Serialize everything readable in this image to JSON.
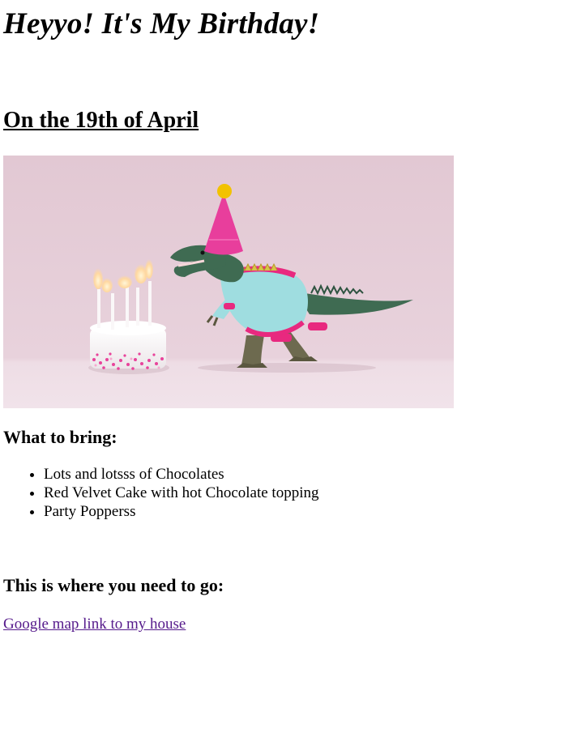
{
  "page": {
    "title": "Heyyo! It's My Birthday!",
    "date_heading": "On the 19th of April",
    "bring_heading": "What to bring:",
    "bring_items": [
      "Lots and lotsss of Chocolates",
      "Red Velvet Cake with hot Chocolate topping",
      "Party Popperss"
    ],
    "go_heading": "This is where you need to go:",
    "map_link_text": "Google map link to my house"
  },
  "image": {
    "description_icon": "dinosaur-birthday-image"
  },
  "colors": {
    "link_visited": "#551a8b",
    "image_background": "#e6cdd8",
    "party_hat": "#e83e9c",
    "pompom": "#f2c200",
    "dino_shirt": "#9fdde0",
    "dino_skin": "#3f6b52"
  }
}
